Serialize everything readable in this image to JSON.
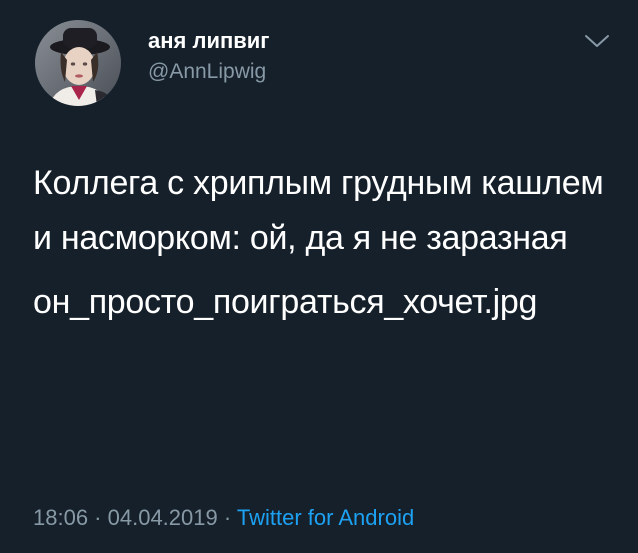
{
  "user": {
    "display_name": "аня липвиг",
    "handle": "@AnnLipwig"
  },
  "tweet": {
    "paragraph1": "Коллега с хриплым грудным кашлем и насморком: ой, да я не заразная",
    "paragraph2": "он_просто_поиграться_хочет.jpg"
  },
  "meta": {
    "time": "18:06",
    "separator1": " · ",
    "date": "04.04.2019",
    "separator2": " · ",
    "source": "Twitter for Android"
  },
  "icons": {
    "menu": "chevron-down-icon",
    "avatar": "avatar"
  },
  "colors": {
    "background": "#15202b",
    "text": "#ffffff",
    "secondary": "#8899a6",
    "link": "#1da1f2"
  }
}
